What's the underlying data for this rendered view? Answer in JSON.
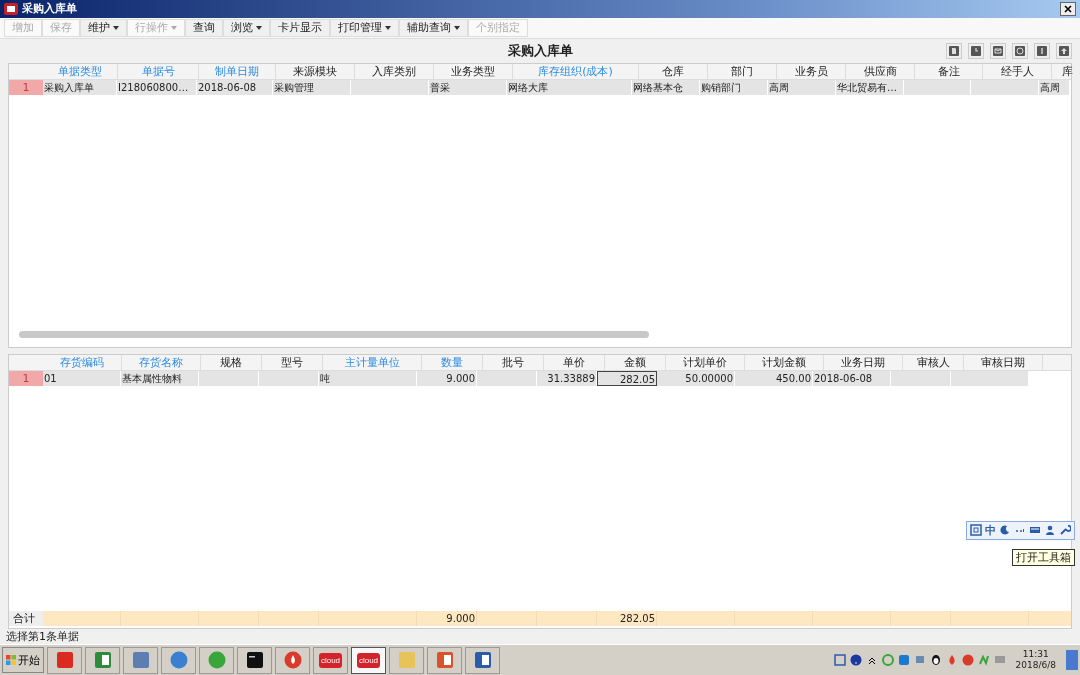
{
  "window": {
    "title": "采购入库单"
  },
  "toolbar": [
    {
      "label": "增加",
      "disabled": true,
      "dropdown": false
    },
    {
      "label": "保存",
      "disabled": true,
      "dropdown": false
    },
    {
      "label": "维护",
      "disabled": false,
      "dropdown": true
    },
    {
      "label": "行操作",
      "disabled": true,
      "dropdown": true
    },
    {
      "label": "查询",
      "disabled": false,
      "dropdown": false
    },
    {
      "label": "浏览",
      "disabled": false,
      "dropdown": true
    },
    {
      "label": "卡片显示",
      "disabled": false,
      "dropdown": false
    },
    {
      "label": "打印管理",
      "disabled": false,
      "dropdown": true
    },
    {
      "label": "辅助查询",
      "disabled": false,
      "dropdown": true
    },
    {
      "label": "个别指定",
      "disabled": true,
      "dropdown": false
    }
  ],
  "heading": "采购入库单",
  "header_icons": [
    {
      "kind": "document"
    },
    {
      "kind": "clock"
    },
    {
      "kind": "mail"
    },
    {
      "kind": "globe"
    },
    {
      "kind": "info"
    },
    {
      "kind": "upload"
    }
  ],
  "list_table": {
    "columns": [
      {
        "label": "单据类型",
        "required": true
      },
      {
        "label": "单据号",
        "required": true
      },
      {
        "label": "制单日期",
        "required": true
      },
      {
        "label": "来源模块",
        "required": false
      },
      {
        "label": "入库类别",
        "required": false
      },
      {
        "label": "业务类型",
        "required": false
      },
      {
        "label": "库存组织(成本)",
        "required": true
      },
      {
        "label": "仓库",
        "required": false
      },
      {
        "label": "部门",
        "required": false
      },
      {
        "label": "业务员",
        "required": false
      },
      {
        "label": "供应商",
        "required": false
      },
      {
        "label": "备注",
        "required": false
      },
      {
        "label": "经手人",
        "required": false
      },
      {
        "label": "库",
        "required": false
      }
    ],
    "rows": [
      {
        "number": "1",
        "selected": true,
        "cells": [
          "采购入库单",
          "I218060800…",
          "2018-06-08",
          "采购管理",
          null,
          "普采",
          "网络大库",
          "网络基本仓",
          "购销部门",
          "高周",
          "华北贸易有…",
          null,
          null,
          "高周"
        ]
      }
    ]
  },
  "detail_table": {
    "columns": [
      {
        "label": "存货编码",
        "required": true,
        "kind": "text"
      },
      {
        "label": "存货名称",
        "required": true,
        "kind": "text"
      },
      {
        "label": "规格",
        "required": false,
        "kind": "text"
      },
      {
        "label": "型号",
        "required": false,
        "kind": "text"
      },
      {
        "label": "主计量单位",
        "required": true,
        "kind": "text"
      },
      {
        "label": "数量",
        "required": true,
        "kind": "number",
        "total": "9.000"
      },
      {
        "label": "批号",
        "required": false,
        "kind": "text"
      },
      {
        "label": "单价",
        "required": false,
        "kind": "number"
      },
      {
        "label": "金额",
        "required": false,
        "kind": "number",
        "total": "282.05"
      },
      {
        "label": "计划单价",
        "required": false,
        "kind": "number"
      },
      {
        "label": "计划金额",
        "required": false,
        "kind": "number"
      },
      {
        "label": "业务日期",
        "required": false,
        "kind": "text"
      },
      {
        "label": "审核人",
        "required": false,
        "kind": "text"
      },
      {
        "label": "审核日期",
        "required": false,
        "kind": "text"
      }
    ],
    "rows": [
      {
        "number": "1",
        "selected": true,
        "cells": [
          {
            "text": "01",
            "selected": false
          },
          {
            "text": "基本属性物料",
            "selected": false
          },
          {
            "text": null,
            "selected": false
          },
          {
            "text": null,
            "selected": false
          },
          {
            "text": "吨",
            "selected": false
          },
          {
            "text": "9.000",
            "selected": false
          },
          {
            "text": null,
            "selected": false
          },
          {
            "text": "31.33889",
            "selected": false
          },
          {
            "text": "282.05",
            "selected": true
          },
          {
            "text": "50.00000",
            "selected": false
          },
          {
            "text": "450.00",
            "selected": false
          },
          {
            "text": "2018-06-08",
            "selected": false
          },
          {
            "text": null,
            "selected": false
          },
          {
            "text": null,
            "selected": false
          }
        ]
      }
    ],
    "total_label": "合计"
  },
  "ime_bar": {
    "mode": "中",
    "tooltip": "打开工具箱"
  },
  "status_bar": "选择第1条单据",
  "taskbar": {
    "start": "开始",
    "apps": [
      {
        "kind": "g",
        "selected": false
      },
      {
        "kind": "excel",
        "selected": false
      },
      {
        "kind": "network",
        "selected": false
      },
      {
        "kind": "globe",
        "selected": false
      },
      {
        "kind": "ie",
        "selected": false
      },
      {
        "kind": "terminal",
        "selected": false
      },
      {
        "kind": "drop",
        "selected": false
      },
      {
        "kind": "cloud",
        "label": "cloud",
        "selected": false
      },
      {
        "kind": "cloud",
        "label": "cloud",
        "selected": true
      },
      {
        "kind": "folder",
        "selected": false
      },
      {
        "kind": "slides",
        "selected": false
      },
      {
        "kind": "word",
        "selected": false
      }
    ],
    "time": "11:31",
    "date": "2018/6/8"
  }
}
